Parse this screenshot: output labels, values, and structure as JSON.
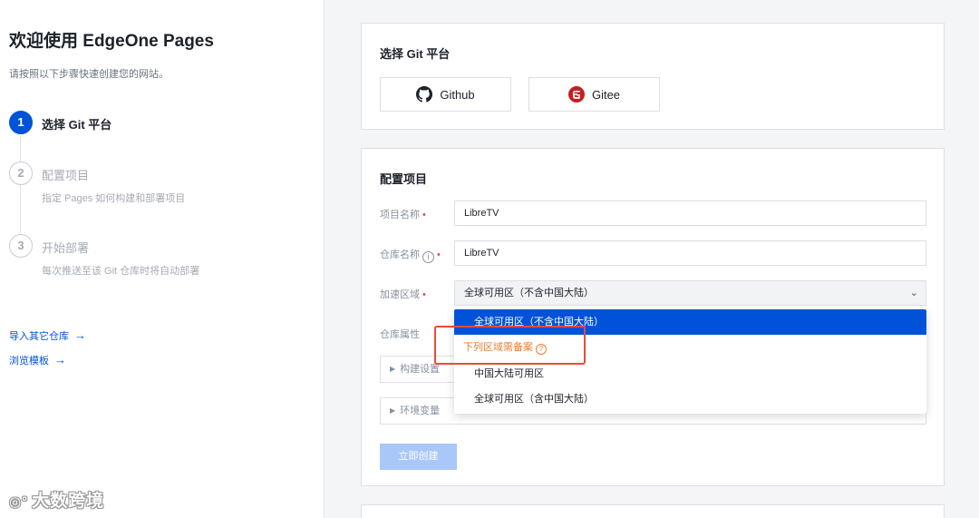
{
  "sidebar": {
    "title": "欢迎使用 EdgeOne Pages",
    "subtitle": "请按照以下步骤快速创建您的网站。",
    "steps": [
      {
        "number": "1",
        "title": "选择 Git 平台",
        "desc": "",
        "active": true
      },
      {
        "number": "2",
        "title": "配置项目",
        "desc": "指定 Pages 如何构建和部署项目",
        "active": false
      },
      {
        "number": "3",
        "title": "开始部署",
        "desc": "每次推送至该 Git 仓库时将自动部署",
        "active": false
      }
    ],
    "links": [
      {
        "label": "导入其它仓库",
        "arrow": "→"
      },
      {
        "label": "浏览模板",
        "arrow": "→"
      }
    ],
    "watermark": "大数跨境"
  },
  "git_platform": {
    "title": "选择 Git 平台",
    "buttons": [
      {
        "label": "Github",
        "icon": "github-icon"
      },
      {
        "label": "Gitee",
        "icon": "gitee-icon"
      }
    ]
  },
  "config": {
    "title": "配置项目",
    "fields": {
      "project_name": {
        "label": "项目名称",
        "value": "LibreTV"
      },
      "repo_name": {
        "label": "仓库名称",
        "value": "LibreTV"
      },
      "region": {
        "label": "加速区域",
        "value": "全球可用区（不含中国大陆）"
      },
      "repo_attr": {
        "label": "仓库属性"
      }
    },
    "collapses": [
      {
        "label": "构建设置"
      },
      {
        "label": "环境变量"
      }
    ],
    "create_button": "立即创建"
  },
  "region_dropdown": {
    "selected": "全球可用区（不含中国大陆）",
    "group_label": "下列区域需备案",
    "options": [
      "中国大陆可用区",
      "全球可用区（含中国大陆）"
    ]
  },
  "colors": {
    "primary": "#0052d9",
    "warning": "#ed7b2f",
    "annotation": "#e74c3c",
    "disabled_button": "#a9c7f8"
  }
}
